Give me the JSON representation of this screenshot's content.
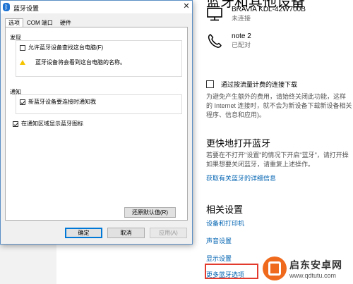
{
  "background": {
    "page_heading": "蓝牙和其他设备",
    "devices": [
      {
        "name": "BRAVIA KDL-42W700B",
        "status": "未连接",
        "icon": "monitor-icon"
      },
      {
        "name": "note 2",
        "status": "已配对",
        "icon": "phone-icon"
      }
    ],
    "metered_checkbox_label": "通过按流量计费的连接下载",
    "metered_desc": [
      "为避免产生额外的费用，请始终关闭此功能，这样",
      "的 Internet 连接时，就不会为新设备下载新设备相关",
      "程序、信息和应用)。"
    ],
    "quick_open_title": "更快地打开蓝牙",
    "quick_open_desc": [
      "若要在不打开\"设置\"的情况下开启\"蓝牙\"，请打开操",
      "如果想要关闭蓝牙，请重复上述操作。"
    ],
    "learn_more_link": "获取有关蓝牙的详细信息",
    "related_title": "相关设置",
    "related_links": [
      "设备和打印机",
      "声音设置",
      "显示设置",
      "更多蓝牙选项"
    ],
    "highlight_color": "#e23a2c"
  },
  "dialog": {
    "title": "蓝牙设置",
    "close_label": "✕",
    "tabs": [
      "选项",
      "COM 端口",
      "硬件"
    ],
    "discovery_label": "发现",
    "allow_discovery_label": "允许蓝牙设备查找这台电脑(F)",
    "allow_discovery_checked": false,
    "warning_text": "蓝牙设备将会看到这台电脑的名称。",
    "notify_label": "通知",
    "notify_new_device_label": "新蓝牙设备要连接时通知我",
    "notify_new_device_checked": true,
    "show_tray_icon_label": "在通知区域显示蓝牙图标",
    "show_tray_icon_checked": true,
    "restore_defaults_label": "还原默认值(R)",
    "ok_label": "确定",
    "cancel_label": "取消",
    "apply_label": "应用(A)",
    "accent_color": "#0078d7"
  },
  "watermark": {
    "title": "启东安卓网",
    "url": "www.qdtutu.com"
  }
}
